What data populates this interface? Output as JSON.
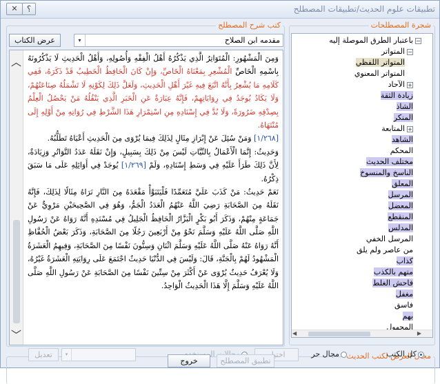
{
  "window": {
    "title": "تطبيقات علوم الحديث/تطبيقات المصطلح",
    "help_label": "؟",
    "close_label": "✕"
  },
  "terms_panel": {
    "legend": "شجرة المصطلحات",
    "items": [
      {
        "label": "باعتبار الطرق الموصلة إليه",
        "expander": "−",
        "level": 0
      },
      {
        "label": "المتواتر",
        "expander": "−",
        "level": 1
      },
      {
        "label": "المتواتر اللفظي",
        "expander": "",
        "level": 2,
        "style": "hl2"
      },
      {
        "label": "المتواتر المعنوي",
        "expander": "",
        "level": 2
      },
      {
        "label": "الآحاد",
        "expander": "+",
        "level": 1
      },
      {
        "label": "زيادة الثقة",
        "expander": "",
        "level": 1,
        "style": "hl"
      },
      {
        "label": "الشاذ",
        "expander": "",
        "level": 1,
        "style": "hl"
      },
      {
        "label": "المنكر",
        "expander": "",
        "level": 1,
        "style": "hl"
      },
      {
        "label": "المتابعة",
        "expander": "+",
        "level": 1
      },
      {
        "label": "الشاهد",
        "expander": "",
        "level": 1,
        "style": "hl"
      },
      {
        "label": "المحكم",
        "expander": "",
        "level": 1
      },
      {
        "label": "مختلف الحديث",
        "expander": "",
        "level": 1,
        "style": "hl"
      },
      {
        "label": "الناسخ والمنسوخ",
        "expander": "",
        "level": 1,
        "style": "hl"
      },
      {
        "label": "المعلق",
        "expander": "",
        "level": 1,
        "style": "hl"
      },
      {
        "label": "المرسل",
        "expander": "",
        "level": 1,
        "style": "hl"
      },
      {
        "label": "المعضل",
        "expander": "",
        "level": 1,
        "style": "hl"
      },
      {
        "label": "المنقطع",
        "expander": "",
        "level": 1,
        "style": "hl"
      },
      {
        "label": "المدلس",
        "expander": "",
        "level": 1,
        "style": "hl"
      },
      {
        "label": "المرسل الخفي",
        "expander": "",
        "level": 1
      },
      {
        "label": "من عاصر ولم يلق",
        "expander": "",
        "level": 1
      },
      {
        "label": "كذاب",
        "expander": "",
        "level": 1,
        "style": "hl"
      },
      {
        "label": "متهم بالكذب",
        "expander": "",
        "level": 1,
        "style": "hl"
      },
      {
        "label": "فاحش الغلط",
        "expander": "",
        "level": 1,
        "style": "hl"
      },
      {
        "label": "مغفل",
        "expander": "",
        "level": 1,
        "style": "hl"
      },
      {
        "label": "فاسق",
        "expander": "",
        "level": 1
      },
      {
        "label": "بهم",
        "expander": "",
        "level": 1,
        "style": "hl"
      },
      {
        "label": "المجهول",
        "expander": "",
        "level": 1
      }
    ],
    "hscroll_left": "◀",
    "hscroll_right": "▶"
  },
  "books_panel": {
    "legend": "كتب شرح المصطلح",
    "show_book_label": "عرض الكتاب",
    "selected_book": "مقدمه ابن الصلاح",
    "select_arrow": "▾",
    "scroll_up": "︿",
    "scroll_down": "﹀",
    "paragraphs": [
      [
        {
          "t": "وَمِنَ الْمَشْهُورِ: الْمُتَوَاتِرُ الَّذِي يَذْكُرُهُ أَهْلُ الْفِقْهِ وَأُصُولِهِ، وَأَهْلُ الْحَدِيثِ لَا يَذْكُرُونَهُ بِاسْمِهِ الْخَاصِّ ",
          "c": ""
        },
        {
          "t": "الْمُشْعِرِ بِمَعْنَاهُ الْخَاصِّ، وَإِنْ كَانَ الْحَافِظُ الْخَطِيبُ قَدْ ذَكَرَهُ، فَفِي كَلَامِهِ مَا يُشْعِرُ بِأَنَّهُ اتَّبَعَ فِيهِ غَيْرَ أَهْلِ الْحَدِيثِ، وَلَعَلَّ ذَلِكَ لِكَوْنِهِ لَا تَشْمَلُهُ صِنَاعَتُهُمْ، وَلَا يَكَادُ يُوجَدُ فِي رِوَايَاتِهِمْ، فَإِنَّهُ عِبَارَةٌ عَنِ الْخَبَرِ الَّذِي يَنْقُلُهُ مَنْ يَحْصُلُ الْعِلْمُ بِصِدْقِهِ ضَرُورَةً، وَلَا بُدَّ فِي إِسْنَادِهِ مِنِ اسْتِمْرَارِ هَذَا الشَّرْطِ فِي رُوَاتِهِ مِنْ أَوَّلِهِ إِلَى مُنْتَهَاهُ.",
          "c": "red"
        }
      ],
      [
        {
          "t": "[١/٢٦٨] ",
          "c": "ref"
        },
        {
          "t": "وَمَنْ سُئِلَ عَنْ إِبْرَازِ مِثَالٍ لِذَلِكَ فِيمَا يُرْوَى مِنَ الْحَدِيثِ أَعْيَاهُ تَطَلُّبُهُ.",
          "c": ""
        }
      ],
      [
        {
          "t": "وَحَدِيثُ: إِنَّمَا الْأَعْمَالُ بِالنِّيَّاتِ لَيْسَ مِنْ ذَلِكَ بِسَبِيلٍ، وَإِنْ نَقَلَهُ عَدَدُ التَّوَاتُرِ وَزِيَادَةٌ، لِأَنَّ ذَلِكَ طَرَأَ عَلَيْهِ فِي وَسَطِ إِسْنَادِهِ، وَلَمْ ",
          "c": ""
        },
        {
          "t": "[١/٢٦٩] ",
          "c": "ref"
        },
        {
          "t": "يُوجَدْ فِي أَوَائِلِهِ عَلَى مَا سَبَقَ ذِكْرُهُ.",
          "c": ""
        }
      ],
      [
        {
          "t": "نَعَمْ حَدِيثُ: مَنْ كَذَبَ عَلَيَّ مُتَعَمِّدًا فَلْيَتَبَوَّأْ مَقْعَدَهُ مِنَ النَّارِ نَرَاهُ مِثَالًا لِذَلِكَ، فَإِنَّهُ نَقَلَهُ مِنَ الصَّحَابَةِ رَضِيَ اللَّهُ عَنْهُمُ الْعَدَدُ الْجَمُّ، وَهُوَ فِي الصَّحِيحَيْنِ مَرْوِيٌّ عَنْ جَمَاعَةٍ مِنْهُمْ، وَذَكَرَ أَبُو بَكْرٍ الْبَزَّارُ الْحَافِظُ الْجَلِيلُ فِي مُسْنَدِهِ أَنَّهُ رَوَاهُ عَنْ رَسُولِ اللَّهِ صَلَّى اللَّهُ عَلَيْهِ وَسَلَّمَ نَحْوٌ مِنْ أَرْبَعِينَ رَجُلًا مِنَ الصَّحَابَةِ، وَذَكَرَ بَعْضُ الْحُفَّاظِ أَنَّهُ رَوَاهُ عَنْهُ صَلَّى اللَّهُ عَلَيْهِ وَسَلَّمَ اثْنَانِ وَسِتُّونَ نَفْسًا مِنَ الصَّحَابَةِ، وَفِيهِمُ الْعَشَرَةُ الْمَشْهُودُ لَهُمْ بِالْجَنَّةِ، قَالَ: وَلَيْسَ فِي الدُّنْيَا حَدِيثٌ اجْتَمَعَ عَلَى رِوَايَتِهِ الْعَشَرَةُ غَيْرُهُ، وَلَا يُعْرَفُ حَدِيثٌ يُرْوَى عَنْ أَكْثَرَ مِنْ سِتِّينَ نَفْسًا مِنَ الصَّحَابَةِ عَنْ رَسُولِ اللَّهِ صَلَّى اللَّهُ عَلَيْهِ وَسَلَّمَ إِلَّا هَذَا الْحَدِيثُ الْوَاحِدُ.",
          "c": ""
        }
      ]
    ]
  },
  "display_mode": {
    "legend": "مجال العرض لكتب الحديث",
    "all_books": "كل الكتب",
    "free_field": "مجال حر",
    "choose": "اختيار",
    "user_fields": "مجالات المستخدم",
    "edit": "تعديل",
    "selected": "all_books"
  },
  "footer": {
    "apply_label": "تطبيق المصطلح",
    "exit_label": "خروج"
  }
}
